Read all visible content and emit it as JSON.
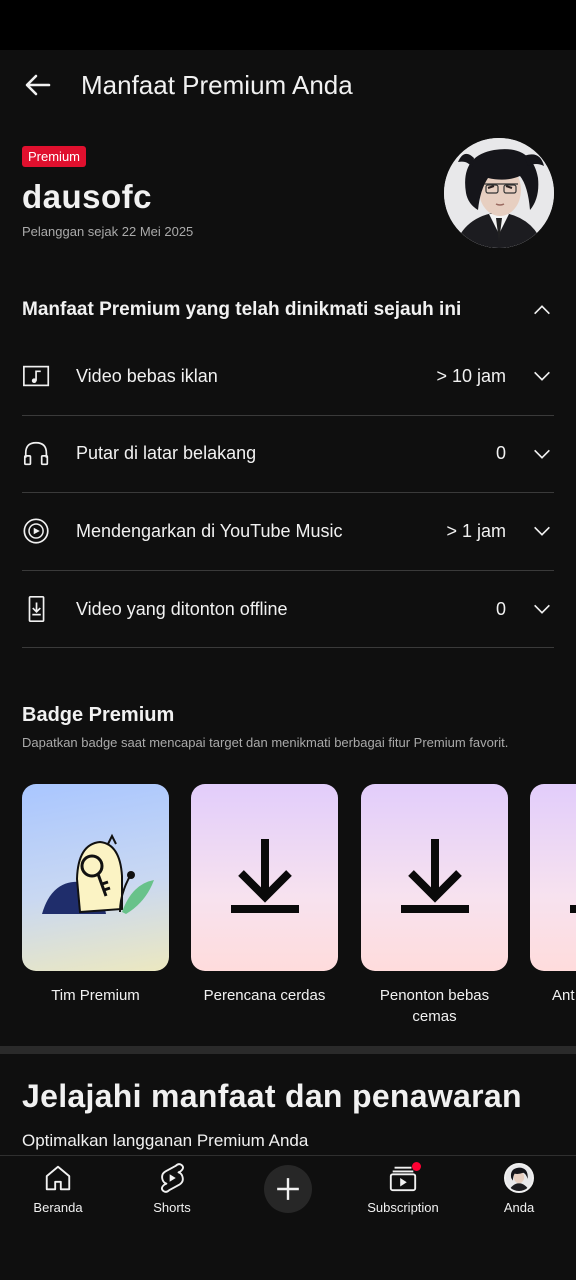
{
  "header": {
    "title": "Manfaat Premium Anda"
  },
  "profile": {
    "badge": "Premium",
    "username": "dausofc",
    "member_since": "Pelanggan sejak 22 Mei 2025"
  },
  "benefits": {
    "heading": "Manfaat Premium yang telah dinikmati sejauh ini",
    "items": [
      {
        "label": "Video bebas iklan",
        "value": "> 10 jam",
        "icon": "music-note-icon"
      },
      {
        "label": "Putar di latar belakang",
        "value": "0",
        "icon": "headphones-icon"
      },
      {
        "label": "Mendengarkan di YouTube Music",
        "value": "> 1 jam",
        "icon": "youtube-music-icon"
      },
      {
        "label": "Video yang ditonton offline",
        "value": "0",
        "icon": "download-phone-icon"
      }
    ]
  },
  "badges": {
    "title": "Badge Premium",
    "subtitle": "Dapatkan badge saat mencapai target dan menikmati berbagai fitur Premium favorit.",
    "items": [
      {
        "name": "Tim Premium"
      },
      {
        "name": "Perencana cerdas"
      },
      {
        "name": "Penonton bebas cemas"
      },
      {
        "name": "Ant"
      }
    ]
  },
  "explore": {
    "title": "Jelajahi manfaat dan penawaran",
    "subtitle": "Optimalkan langganan Premium Anda"
  },
  "bottom_nav": {
    "home": "Beranda",
    "shorts": "Shorts",
    "subscription": "Subscription",
    "you": "Anda"
  },
  "colors": {
    "background": "#0f0f0f",
    "premium_badge": "#e0102e",
    "notification_dot": "#ff0033"
  }
}
